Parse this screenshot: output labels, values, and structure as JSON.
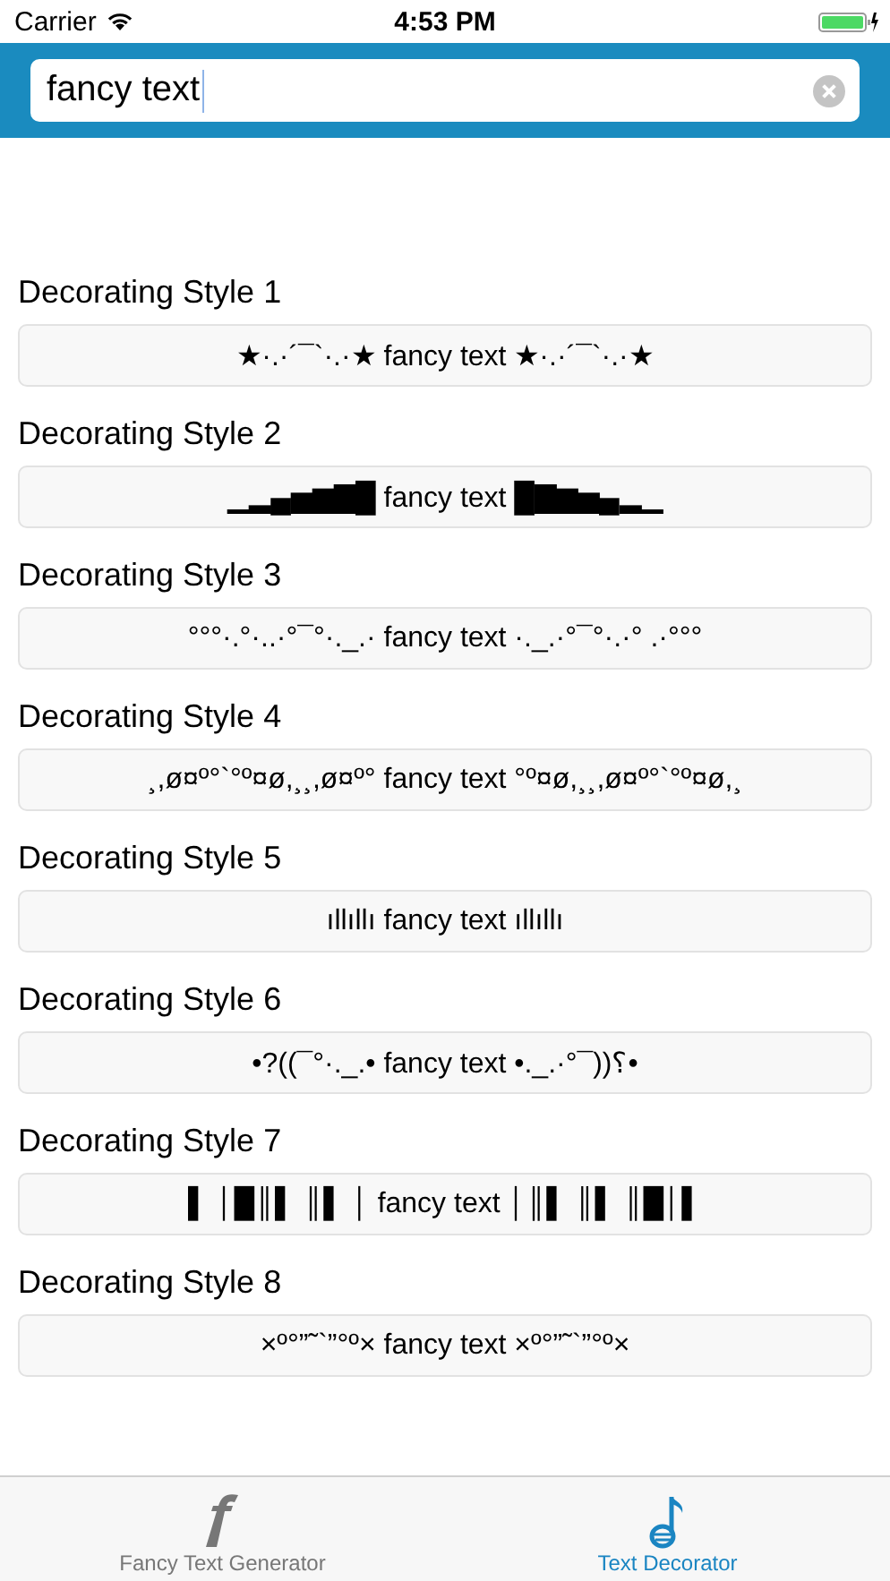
{
  "status_bar": {
    "carrier": "Carrier",
    "time": "4:53 PM"
  },
  "search": {
    "value": "fancy text"
  },
  "styles": [
    {
      "title": "Decorating Style 1",
      "result": "★·.·´¯`·.·★ fancy text ★·.·´¯`·.·★"
    },
    {
      "title": "Decorating Style 2",
      "result": "▁▂▄▅▆▇█ fancy text █▇▆▅▄▂▁"
    },
    {
      "title": "Decorating Style 3",
      "result": "°°°·.°·..·°¯°·._.· fancy text ·._.·°¯°·.·° .·°°°"
    },
    {
      "title": "Decorating Style 4",
      "result": "¸,ø¤º°`°º¤ø,¸¸,ø¤º° fancy text °º¤ø,¸¸,ø¤º°`°º¤ø,¸"
    },
    {
      "title": "Decorating Style 5",
      "result": "ıllıllı fancy text ıllıllı"
    },
    {
      "title": "Decorating Style 6",
      "result": "•?((¯°·._.• fancy text •._.·°¯))؟•"
    },
    {
      "title": "Decorating Style 7",
      "result": "▌ │█║▌ ║▌ │ fancy text │║▌ ║▌ ║█│▌"
    },
    {
      "title": "Decorating Style 8",
      "result": "×º°”˜`”°º× fancy text ×º°”˜`”°º×"
    }
  ],
  "tabs": [
    {
      "label": "Fancy Text Generator",
      "kind": "f",
      "selected": false
    },
    {
      "label": "Text Decorator",
      "kind": "note",
      "selected": true
    }
  ]
}
